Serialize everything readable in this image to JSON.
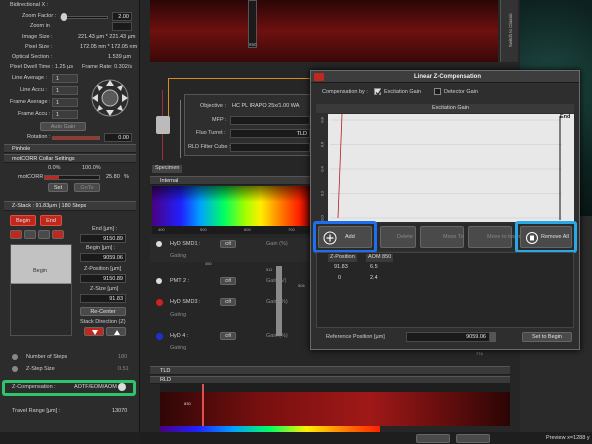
{
  "left_panel": {
    "bidirectional_label": "Bidirectional X :",
    "zoom_factor_label": "Zoom Factor :",
    "zoom_factor_value": "2.00",
    "zoom_in_label": "Zoom in",
    "image_size_label": "Image Size :",
    "image_size_value": "221.43 µm * 221.43 µm",
    "pixel_size_label": "Pixel Size :",
    "pixel_size_value": "172.05 nm * 172.05 nm",
    "optical_section_label": "Optical Section :",
    "optical_section_value": "1.539 µm",
    "pixel_dwell_label": "Pixel Dwell Time : 1.25 µs",
    "frame_rate_label": "Frame Rate: 0.302/s",
    "line_average_label": "Line Average :",
    "line_average_value": "1",
    "line_accu_label": "Line Accu :",
    "line_accu_value": "1",
    "frame_average_label": "Frame Average :",
    "frame_average_value": "1",
    "frame_accu_label": "Frame Accu :",
    "frame_accu_value": "1",
    "auto_gain_label": "Auto Gain",
    "rotation_label": "Rotation :",
    "rotation_value": "0.00",
    "pinhole_label": "Pinhole",
    "motcorr_header": "motCORR Collar Settings",
    "motcorr_pct_0": "0.0%",
    "motcorr_pct_100": "100.0%",
    "motcorr_label": "motCORR :",
    "motcorr_value": "25.80",
    "motcorr_unit": "%",
    "set_label": "Set",
    "goto_label": "GoTo"
  },
  "zstack": {
    "header": "Z-Stack : 91.83µm | 180 Steps",
    "begin_label": "Begin",
    "end_label": "End",
    "end_um_label": "End [µm] :",
    "end_um_value": "9150.89",
    "begin_um_label": "Begin [µm] :",
    "begin_um_value": "9059.06",
    "begin_marker": "Begin",
    "zpos_label": "Z-Position [µm]",
    "zpos_value": "9150.89",
    "zsize_label": "Z-Size [µm]",
    "zsize_value": "91.83",
    "recenter_label": "Re-Center",
    "stack_dir_label": "Stack Direction (Z)",
    "num_steps_label": "Number of Steps",
    "num_steps_value": "180",
    "zstep_label": "Z-Step Size",
    "zstep_value": "0.51",
    "zcomp_label": "Z-Compensation :",
    "zcomp_value": "AOTF/EOM/AOM",
    "travel_label": "Travel Range [µm] :",
    "travel_value": "13070"
  },
  "center": {
    "objective_label": "Objective :",
    "objective_value": "HC PL IRAPO 25x/1.00 WA",
    "mfp_label": "MFP :",
    "fluo_turret_label": "Fluo Turret :",
    "fluo_turret_value": "TLD",
    "rld_label": "RLD Filter Cube :",
    "specimen_label": "Specimen",
    "internal_label": "Internal",
    "hyd1_label": "HyD SMD1 :",
    "hyd1_gain": "Gain (%)",
    "gating_label": "Gating",
    "pmt2_label": "PMT 2 :",
    "pmt2_gain": "Gain (V)",
    "hyd3_label": "HyD SMD3 :",
    "hyd3_gain": "Gain (%)",
    "hyd4_label": "HyD 4 :",
    "hyd4_gain": "Gain (%)",
    "off_label": "Off",
    "tld_label": "TLD",
    "rld_section": "RLD",
    "nm_ticks": [
      "800",
      "900",
      "1,000",
      "1,100",
      "1,200",
      "1,300",
      "1,400",
      "1,500",
      "1,600"
    ],
    "spectrum_ticks": [
      "400",
      "500",
      "600",
      "700"
    ],
    "readout_450": "450",
    "readout_511": "511",
    "readout_506": "506",
    "readout_774": "774",
    "readout_830": "830",
    "top_value": "650",
    "right_vertical_text": "Switch to Classic"
  },
  "dialog": {
    "title": "Linear Z-Compensation",
    "comp_by_label": "Compensation by :",
    "excitation_gain_label": "Excitation Gain",
    "detector_gain_label": "Detector Gain",
    "chart_title": "Excitation Gain",
    "end_label": "End",
    "y_ticks": [
      "0.8",
      "0.6",
      "0.4",
      "0.2",
      "0.0"
    ],
    "add_label": "Add",
    "delete_label": "Delete",
    "move_to_label": "Move To",
    "move_begin_label": "Move to begin",
    "remove_all_label": "Remove All",
    "col_zpos": "Z-Position",
    "col_aom": "AOM 850",
    "rows": [
      [
        "91.83",
        "6.5"
      ],
      [
        "0",
        "2.4"
      ]
    ],
    "ref_pos_label": "Reference Position [µm]",
    "ref_pos_value": "9059.06",
    "set_to_begin_label": "Set to Begin"
  },
  "status": {
    "preview_label": "Preview x=1288 y"
  },
  "chart_data": {
    "type": "line",
    "title": "Excitation Gain",
    "y_ticks": [
      "0.8",
      "0.6",
      "0.4",
      "0.2",
      "0.0"
    ],
    "series": [
      {
        "values": [
          0.0,
          0.85
        ]
      }
    ]
  },
  "colors": {
    "accent_red": "#c0281e",
    "highlight_green": "#2fc46b",
    "highlight_blue": "#1e6ef0",
    "highlight_cyan": "#2aa8e6",
    "panel_bg": "#2c2c2c"
  }
}
